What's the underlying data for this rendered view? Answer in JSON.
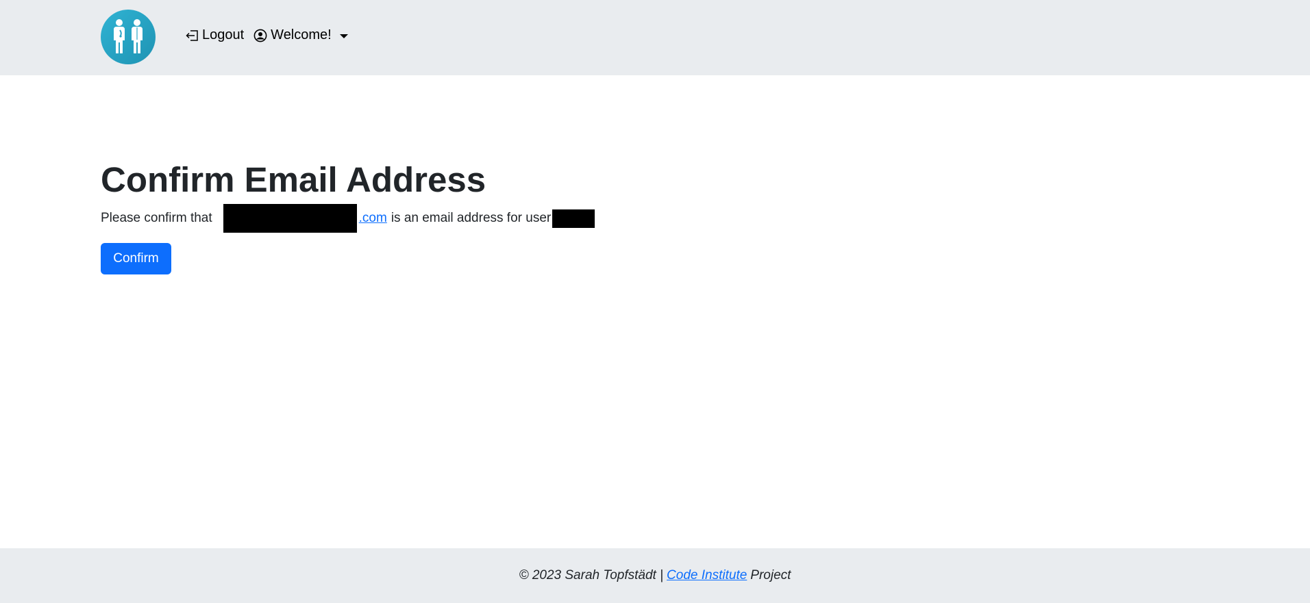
{
  "navbar": {
    "logo_icon": "two-people-logo-icon",
    "logout_label": "Logout",
    "logout_icon": "logout-icon",
    "welcome_label": "Welcome!",
    "welcome_icon": "user-circle-icon",
    "dropdown_icon": "caret-down-icon"
  },
  "main": {
    "title": "Confirm Email Address",
    "text_prefix": "Please confirm that",
    "email_suffix": ".com",
    "text_middle": "is an email address for user",
    "confirm_label": "Confirm"
  },
  "footer": {
    "copyright": "© 2023 Sarah Topfstädt |",
    "link_label": "Code Institute",
    "suffix": "Project"
  },
  "colors": {
    "navbar_bg": "#e9ecef",
    "primary": "#0d6efd",
    "logo_bg": "#2aa6c7",
    "redaction": "#000000"
  }
}
